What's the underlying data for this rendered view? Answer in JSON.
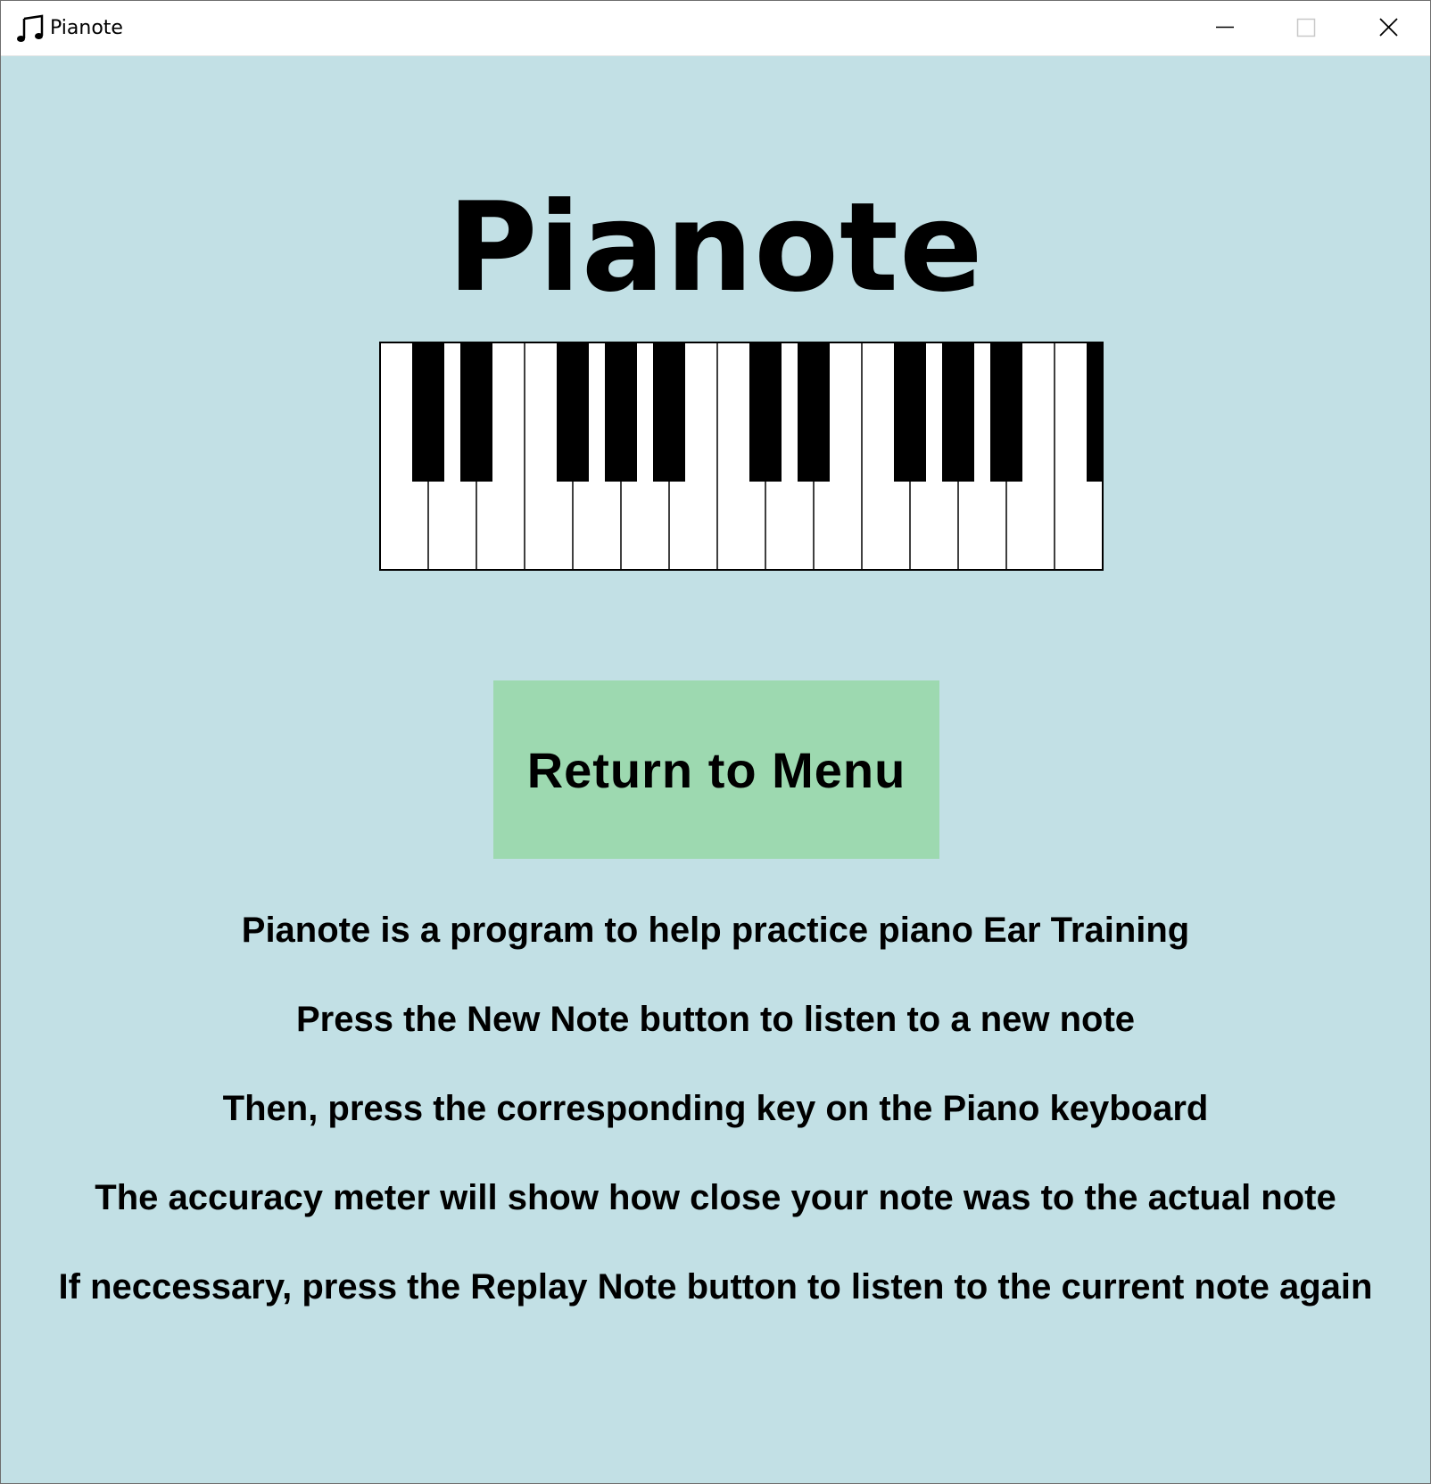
{
  "window": {
    "title": "Pianote",
    "app_icon": "music-note-icon",
    "controls": [
      "minimize-icon",
      "maximize-icon",
      "close-icon"
    ]
  },
  "main": {
    "heading": "Pianote",
    "illustration": "piano-keyboard",
    "menu_button_label": "Return to Menu",
    "instructions": [
      "Pianote is a program to help practice piano Ear Training",
      "Press the New Note button to listen to a new note",
      "Then, press the corresponding key on the Piano keyboard",
      "The accuracy meter will show how close your note was to the actual note",
      "If neccessary, press the Replay Note button to listen to the current note again"
    ]
  },
  "colors": {
    "background": "#c2e0e5",
    "button": "#9dd9b0",
    "titlebar": "#ffffff",
    "text": "#000000"
  }
}
